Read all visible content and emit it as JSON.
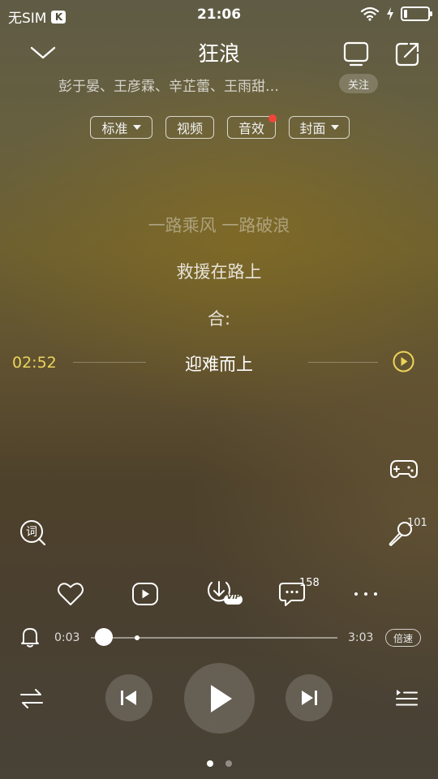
{
  "status_bar": {
    "carrier": "无SIM",
    "carrier_badge": "K",
    "time": "21:06"
  },
  "song": {
    "title": "狂浪",
    "artists": "彭于晏、王彦霖、辛芷蕾、王雨甜…",
    "follow_label": "关注"
  },
  "mode_pills": {
    "standard": "标准",
    "video": "视频",
    "sound_effect": "音效",
    "cover": "封面"
  },
  "lyrics": {
    "line1": "一路乘风 一路破浪",
    "line2": "救援在路上",
    "line3": "合:",
    "current": "迎难而上",
    "current_time": "02:52"
  },
  "side_actions": {
    "sing_count": "101"
  },
  "actions": {
    "comment_count": "158",
    "download_badge": "VIP"
  },
  "progress": {
    "elapsed": "0:03",
    "total": "3:03",
    "fraction": 0.017,
    "speed_label": "倍速"
  },
  "pager": {
    "pages": 2,
    "active": 0
  },
  "colors": {
    "accent": "#ecd45a",
    "badge_red": "#f0463a"
  },
  "icons": [
    "chevron-down-icon",
    "tv-icon",
    "share-icon",
    "gamepad-icon",
    "lyrics-icon",
    "microphone-icon",
    "heart-icon",
    "video-play-icon",
    "download-icon",
    "comment-icon",
    "more-icon",
    "bell-icon",
    "shuffle-icon",
    "previous-icon",
    "play-icon",
    "next-icon",
    "playlist-icon"
  ]
}
